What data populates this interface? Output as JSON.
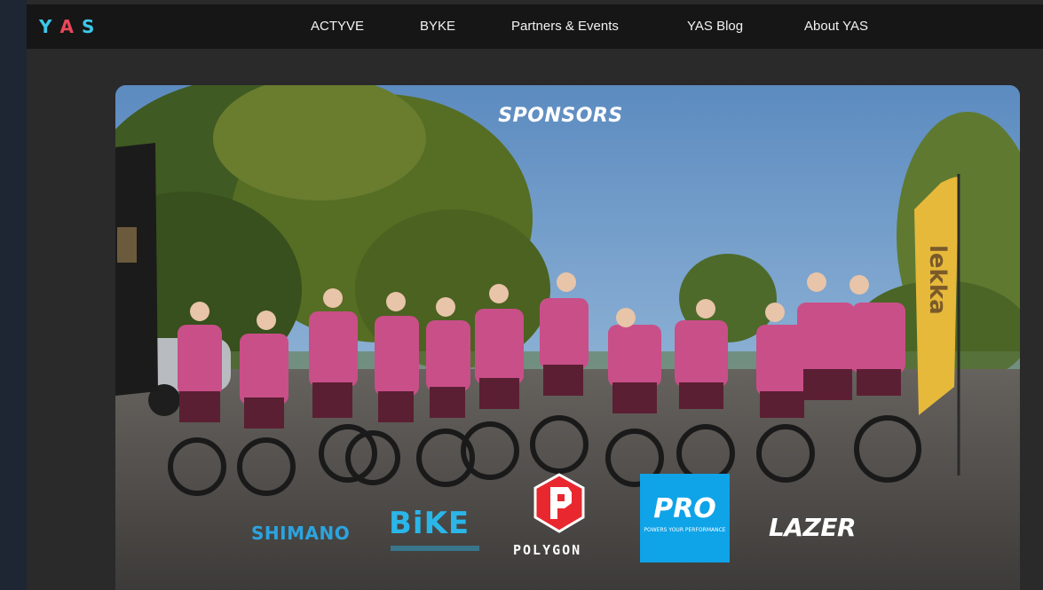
{
  "nav": {
    "logo_letters": [
      {
        "char": "Y",
        "color": "#3cc7e8"
      },
      {
        "char": "A",
        "color": "#e8485a"
      },
      {
        "char": "S",
        "color": "#3cc7e8"
      }
    ],
    "links": [
      {
        "label": "ACTYVE"
      },
      {
        "label": "BYKE"
      },
      {
        "label": "Partners & Events"
      },
      {
        "label": "YAS Blog"
      },
      {
        "label": "About YAS"
      }
    ]
  },
  "hero": {
    "title": "SPONSORS",
    "sponsors": {
      "shimano": "SHIMANO",
      "bike": "BiKE",
      "polygon": "POLYGON",
      "pro_main": "PRO",
      "pro_tagline": "POWERS YOUR PERFORMANCE",
      "lazer": "LAZER"
    },
    "banner_text": "lekka"
  }
}
